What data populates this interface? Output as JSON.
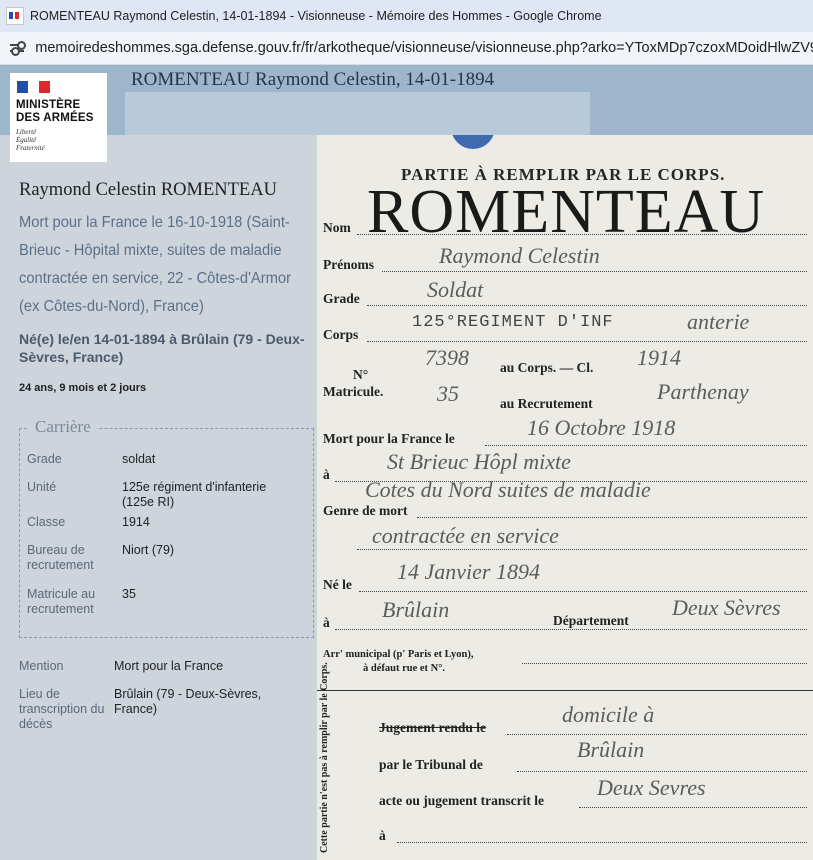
{
  "browser": {
    "window_title": "ROMENTEAU Raymond Celestin, 14-01-1894 - Visionneuse - Mémoire des Hommes - Google Chrome",
    "url": "memoiredeshommes.sga.defense.gouv.fr/fr/arkotheque/visionneuse/visionneuse.php?arko=YToxMDp7czoxMDoidHlwZV9mb2"
  },
  "logo": {
    "line1": "MINISTÈRE",
    "line2": "DES ARMÉES",
    "motto": [
      "Liberté",
      "Égalité",
      "Fraternité"
    ],
    "colors": {
      "blue": "#1f4fa8",
      "white": "#ffffff",
      "red": "#e1262d"
    }
  },
  "header": {
    "title": "ROMENTEAU Raymond Celestin, 14-01-1894"
  },
  "person": {
    "name": "Raymond Celestin ROMENTEAU",
    "death": "Mort pour la France le 16-10-1918 (Saint-Brieuc - Hôpital mixte, suites de maladie contractée en service, 22 - Côtes-d'Armor (ex Côtes-du-Nord), France)",
    "birth": "Né(e) le/en 14-01-1894 à Brûlain (79 - Deux-Sèvres, France)",
    "age": "24 ans, 9 mois et 2 jours"
  },
  "career": {
    "legend": "Carrière",
    "rows": [
      {
        "label": "Grade",
        "value": "soldat"
      },
      {
        "label": "Unité",
        "value": "125e régiment d'infanterie (125e RI)"
      },
      {
        "label": "Classe",
        "value": "1914"
      },
      {
        "label": "Bureau de recrutement",
        "value": "Niort (79)"
      },
      {
        "label": "Matricule au recrutement",
        "value": "35"
      }
    ]
  },
  "extra": [
    {
      "label": "Mention",
      "value": "Mort pour la France"
    },
    {
      "label": "Lieu de transcription du décès",
      "value": "Brûlain (79 - Deux-Sèvres, France)"
    }
  ],
  "document": {
    "title": "PARTIE À REMPLIR PAR LE CORPS.",
    "surname": "ROMENTEAU",
    "labels": {
      "nom": "Nom",
      "prenoms": "Prénoms",
      "grade": "Grade",
      "corps": "Corps",
      "no": "N°",
      "matricule": "Matricule.",
      "au_corps": "au Corps. — Cl.",
      "au_recrutement": "au Recrutement",
      "mort": "Mort pour la France le",
      "a": "à",
      "genre": "Genre de mort",
      "ne": "Né le",
      "a2": "à",
      "departement": "Département",
      "arr1": "Arr' municipal (p' Paris et Lyon),",
      "arr2": "à défaut rue et N°.",
      "jugement": "Jugement rendu le",
      "tribunal": "par le Tribunal de",
      "acte": "acte ou jugement transcrit le",
      "a3": "à",
      "side": "Cette partie n'est pas à remplir par le Corps."
    },
    "handwriting": {
      "prenoms": "Raymond Celestin",
      "grade": "Soldat",
      "corps_stamp": "125°REGIMENT D'INF",
      "corps_hw": "anterie",
      "no_corps": "7398",
      "classe": "1914",
      "no_recr": "35",
      "recrutement": "Parthenay",
      "mort_date": "16 Octobre 1918",
      "mort_lieu": "St Brieuc Hôpl mixte",
      "genre1": "Cotes du Nord  suites de maladie",
      "genre2": "contractée en service",
      "ne_date": "14 Janvier 1894",
      "ne_lieu": "Brûlain",
      "departement": "Deux Sèvres",
      "domicile": "domicile à",
      "tribunal": "Brûlain",
      "acte": "Deux Sevres"
    }
  }
}
